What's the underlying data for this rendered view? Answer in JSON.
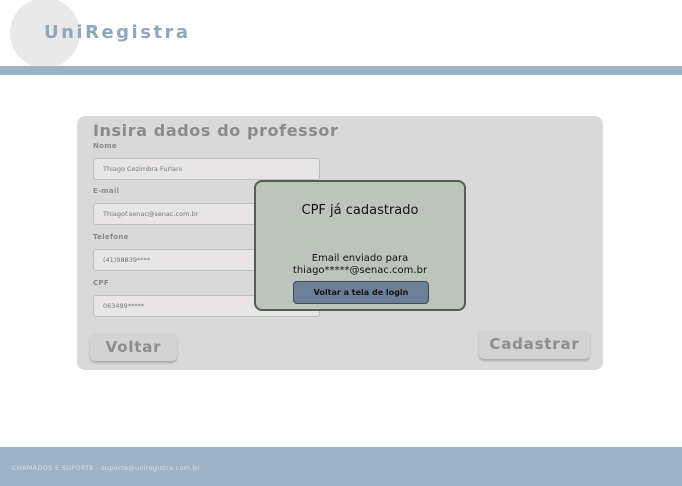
{
  "header": {
    "logo": "UniRegistra"
  },
  "form": {
    "title": "Insira dados do professor",
    "fields": [
      {
        "label": "Nome",
        "value": "Thiago Cezimbra Furlani"
      },
      {
        "label": "E-mail",
        "value": "Thiagof.senac@senac.com.br"
      },
      {
        "label": "Telefone",
        "value": "(41)98839****"
      },
      {
        "label": "CPF",
        "value": "063499*****"
      }
    ],
    "back_label": "Voltar",
    "submit_label": "Cadastrar"
  },
  "modal": {
    "title": "CPF já cadastrado",
    "line1": "Email enviado para",
    "line2": "thiago*****@senac.com.br",
    "button_label": "Voltar a tela de login"
  },
  "footer": {
    "text": "CHAMADOS E SUPORTE - suporte@uniregistra.com.br"
  },
  "colors": {
    "accent": "#9cb3c5",
    "modal_button": "#6b7f96",
    "modal_bg": "#bcc4bc"
  }
}
